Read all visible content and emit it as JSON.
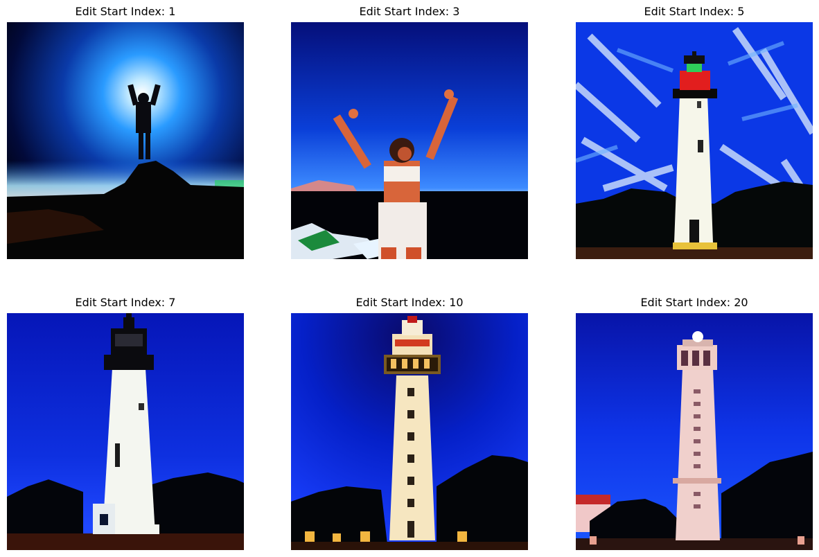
{
  "panels": [
    {
      "title": "Edit Start Index: 1",
      "subject": "person-on-hill-silhouette"
    },
    {
      "title": "Edit Start Index: 3",
      "subject": "woman-arms-raised-beach"
    },
    {
      "title": "Edit Start Index: 5",
      "subject": "lighthouse-red-lantern"
    },
    {
      "title": "Edit Start Index: 7",
      "subject": "white-lighthouse"
    },
    {
      "title": "Edit Start Index: 10",
      "subject": "banded-lighthouse"
    },
    {
      "title": "Edit Start Index: 20",
      "subject": "pink-lighthouse"
    }
  ]
}
